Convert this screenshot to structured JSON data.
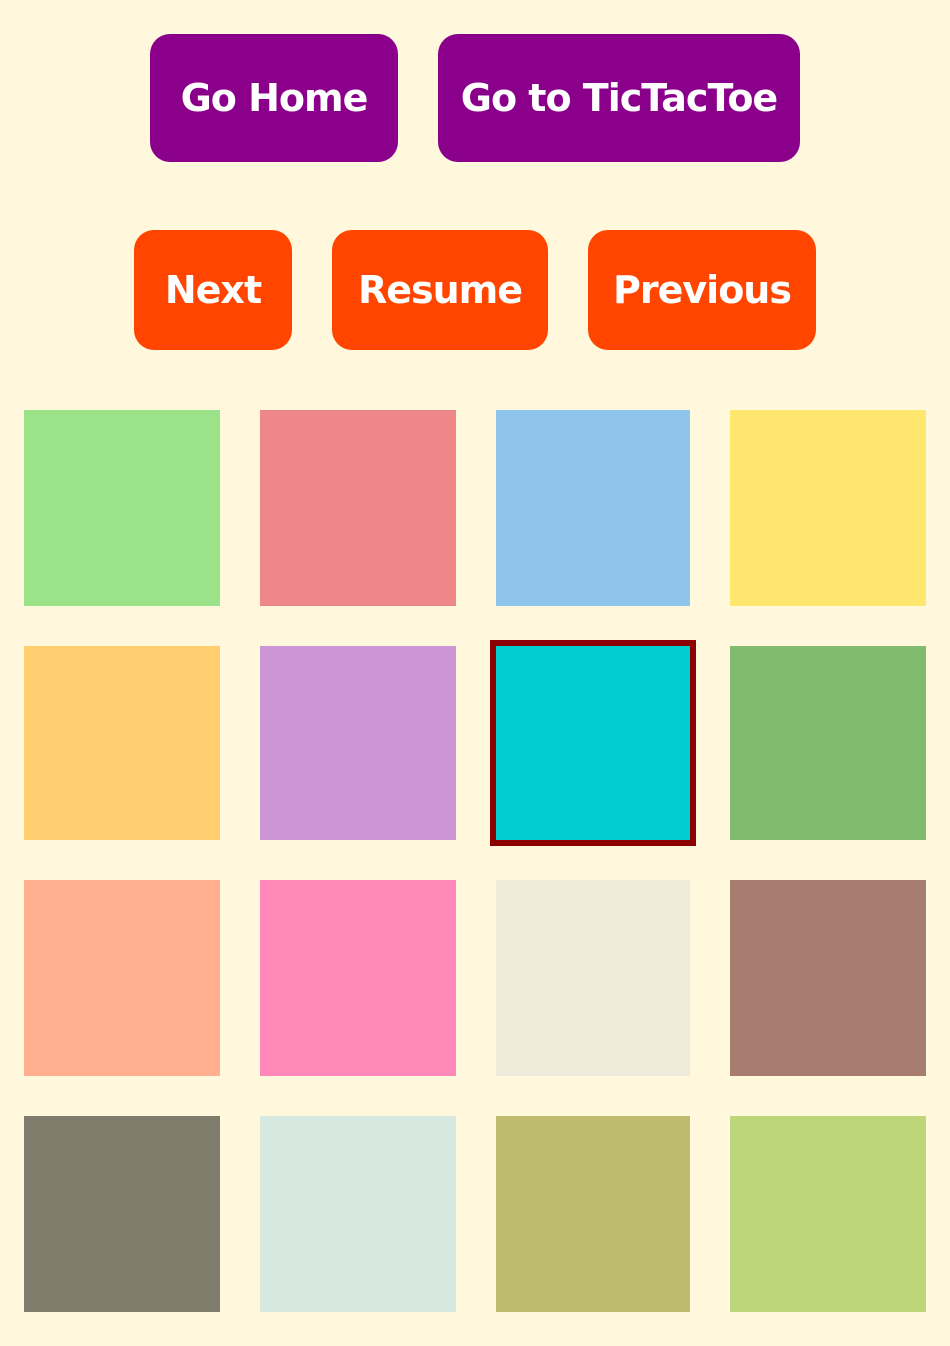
{
  "nav": {
    "home_label": "Go Home",
    "tictactoe_label": "Go to TicTacToe"
  },
  "controls": {
    "next_label": "Next",
    "resume_label": "Resume",
    "previous_label": "Previous"
  },
  "colors": {
    "background": "#fff8dc",
    "nav_button": "#8b008b",
    "control_button": "#ff4500",
    "selected_border": "#8b0000"
  },
  "tiles": [
    {
      "color": "#9be389",
      "selected": false
    },
    {
      "color": "#ef8789",
      "selected": false
    },
    {
      "color": "#8fc4eb",
      "selected": false
    },
    {
      "color": "#ffe66e",
      "selected": false
    },
    {
      "color": "#ffcf70",
      "selected": false
    },
    {
      "color": "#cc95d6",
      "selected": false
    },
    {
      "color": "#00ced1",
      "selected": true
    },
    {
      "color": "#80bb6e",
      "selected": false
    },
    {
      "color": "#ffae90",
      "selected": false
    },
    {
      "color": "#ff88b8",
      "selected": false
    },
    {
      "color": "#efebdb",
      "selected": false
    },
    {
      "color": "#a77d72",
      "selected": false
    },
    {
      "color": "#807c6b",
      "selected": false
    },
    {
      "color": "#d7e8e1",
      "selected": false
    },
    {
      "color": "#bfbb6e",
      "selected": false
    },
    {
      "color": "#bed67a",
      "selected": false
    }
  ]
}
